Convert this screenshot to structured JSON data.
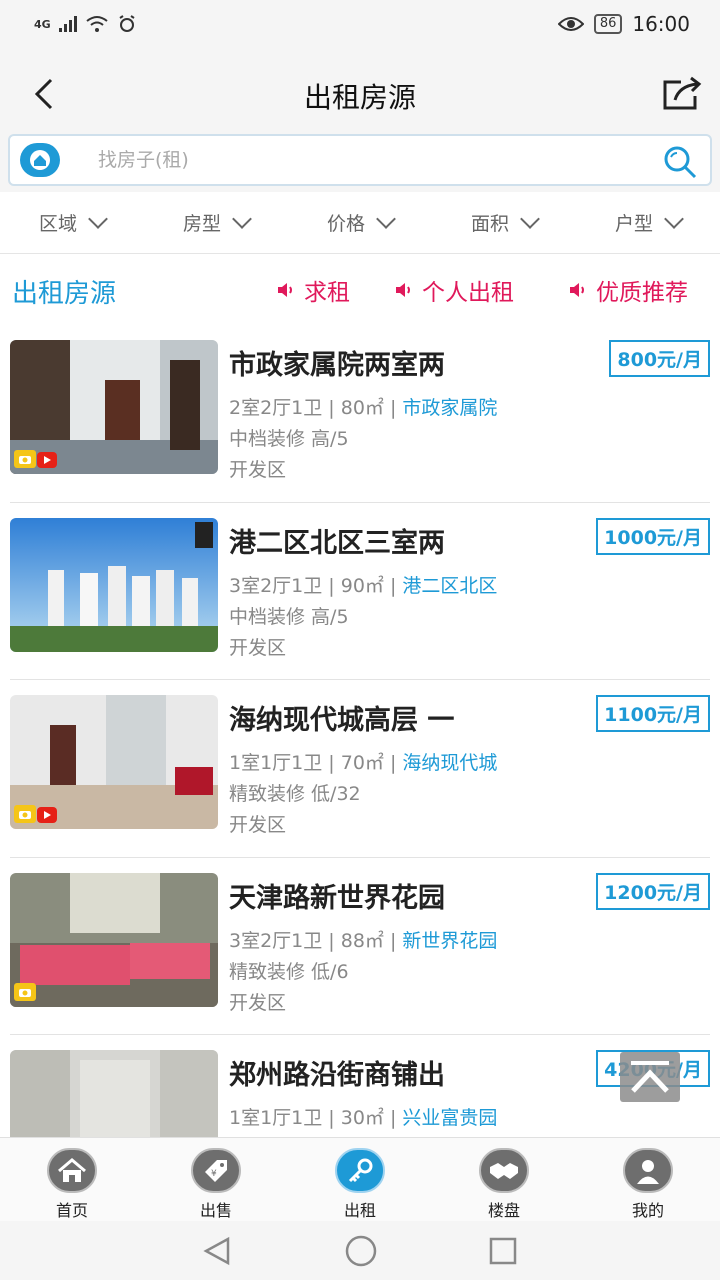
{
  "status_bar": {
    "network": "4G",
    "battery": "86",
    "time": "16:00"
  },
  "header": {
    "title": "出租房源"
  },
  "search": {
    "placeholder": "找房子(租)"
  },
  "filters": [
    {
      "label": "区域"
    },
    {
      "label": "房型"
    },
    {
      "label": "价格"
    },
    {
      "label": "面积"
    },
    {
      "label": "户型"
    }
  ],
  "section": {
    "title": "出租房源",
    "links": [
      {
        "label": "求租"
      },
      {
        "label": "个人出租"
      },
      {
        "label": "优质推荐"
      }
    ]
  },
  "listings": [
    {
      "title": "市政家属院两室两",
      "price": "800元/月",
      "layout": "2室2厅1卫",
      "size": "80㎡",
      "estate": "市政家属院",
      "decoration": "中档装修 高/5",
      "district": "开发区",
      "photo": "interior-hallway",
      "badges": [
        "camera",
        "video"
      ]
    },
    {
      "title": "港二区北区三室两",
      "price": "1000元/月",
      "layout": "3室2厅1卫",
      "size": "90㎡",
      "estate": "港二区北区",
      "decoration": "中档装修 高/5",
      "district": "开发区",
      "photo": "exterior-towers",
      "badges": []
    },
    {
      "title": "海纳现代城高层 一",
      "price": "1100元/月",
      "layout": "1室1厅1卫",
      "size": "70㎡",
      "estate": "海纳现代城",
      "decoration": "精致装修 低/32",
      "district": "开发区",
      "photo": "interior-room",
      "badges": [
        "camera",
        "video"
      ]
    },
    {
      "title": "天津路新世界花园",
      "price": "1200元/月",
      "layout": "3室2厅1卫",
      "size": "88㎡",
      "estate": "新世界花园",
      "decoration": "精致装修 低/6",
      "district": "开发区",
      "photo": "interior-bedroom",
      "badges": [
        "camera"
      ]
    },
    {
      "title": "郑州路沿街商铺出",
      "price": "4200元/月",
      "layout": "1室1厅1卫",
      "size": "30㎡",
      "estate": "兴业富贵园",
      "decoration": "",
      "district": "",
      "photo": "interior-shop",
      "badges": []
    }
  ],
  "bottom_nav": [
    {
      "label": "首页",
      "icon": "home-icon"
    },
    {
      "label": "出售",
      "icon": "price-tag-icon"
    },
    {
      "label": "出租",
      "icon": "key-icon",
      "active": true
    },
    {
      "label": "楼盘",
      "icon": "handshake-icon"
    },
    {
      "label": "我的",
      "icon": "user-icon"
    }
  ],
  "colors": {
    "accent": "#1e9ad6",
    "highlight": "#e0195b"
  }
}
